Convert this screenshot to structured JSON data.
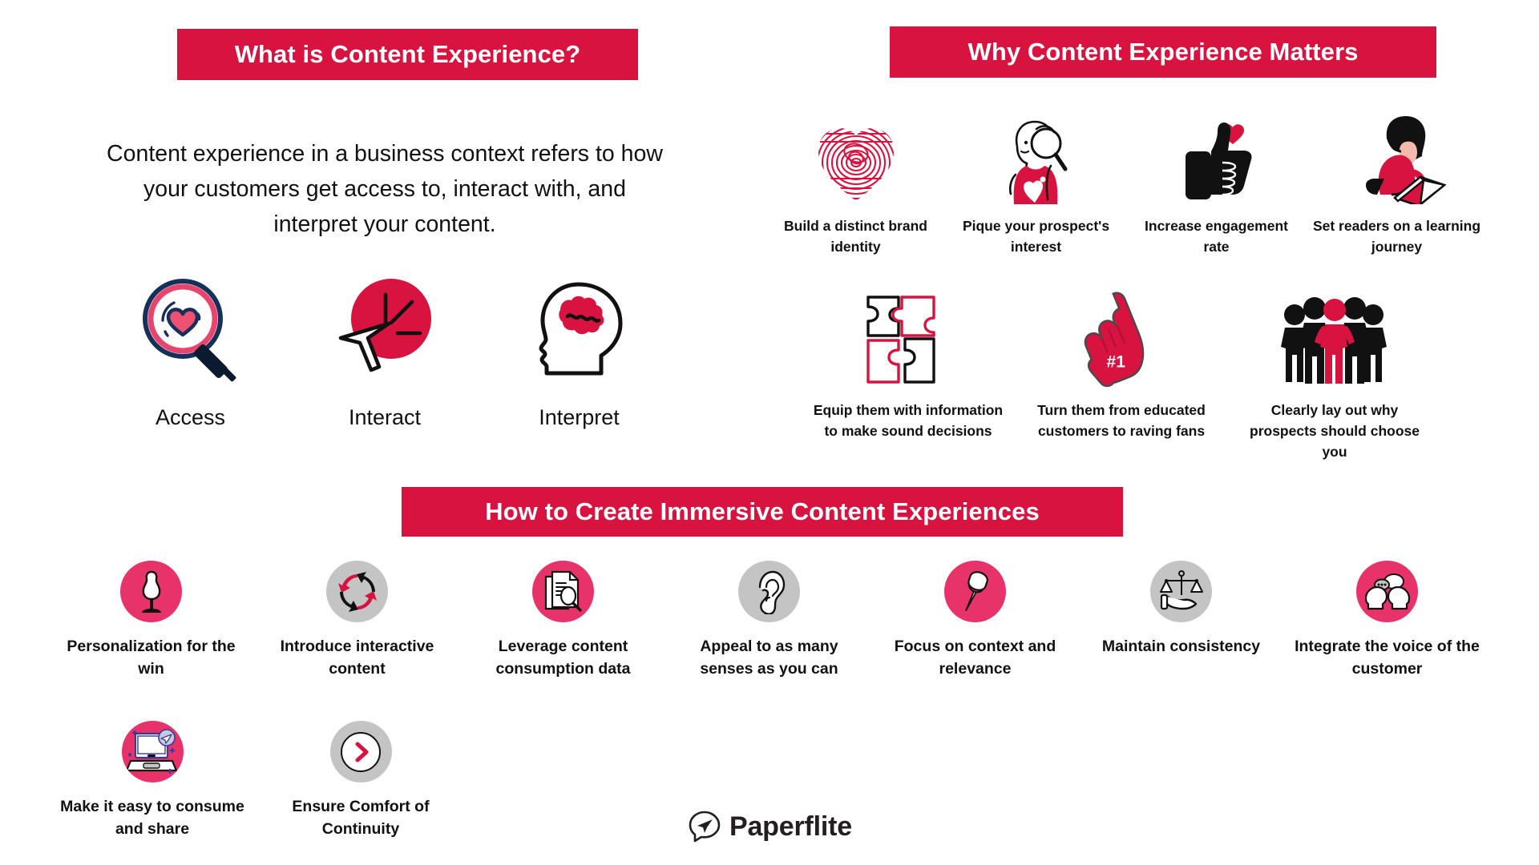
{
  "colors": {
    "crimson": "#D8133F",
    "pink": "#E8336A",
    "gray": "#C4C4C4",
    "navy": "#17305A",
    "black": "#111111"
  },
  "sections": {
    "what": {
      "title": "What is Content Experience?",
      "description": "Content experience in a business context refers to how your customers get access to, interact with, and interpret your content.",
      "items": [
        {
          "label": "Access",
          "icon": "magnifier-heart-icon"
        },
        {
          "label": "Interact",
          "icon": "cursor-click-icon"
        },
        {
          "label": "Interpret",
          "icon": "head-brain-icon"
        }
      ]
    },
    "why": {
      "title": "Why Content Experience Matters",
      "row1": [
        {
          "label": "Build a distinct brand identity",
          "icon": "fingerprint-heart-icon"
        },
        {
          "label": "Pique your prospect's interest",
          "icon": "person-magnifier-icon"
        },
        {
          "label": "Increase engagement rate",
          "icon": "thumbs-up-heart-icon"
        },
        {
          "label": "Set readers on a learning journey",
          "icon": "reader-book-icon"
        }
      ],
      "row2": [
        {
          "label": "Equip them with information to make sound decisions",
          "icon": "puzzle-pieces-icon"
        },
        {
          "label": "Turn them from educated customers to raving fans",
          "icon": "foam-finger-icon"
        },
        {
          "label": "Clearly lay out why prospects should choose you",
          "icon": "crowd-people-icon"
        }
      ]
    },
    "how": {
      "title": "How to Create Immersive Content Experiences",
      "row1": [
        {
          "label": "Personalization for the win",
          "icon": "mannequin-icon",
          "badge": "pink"
        },
        {
          "label": "Introduce interactive content",
          "icon": "cycle-arrows-icon",
          "badge": "gray"
        },
        {
          "label": "Leverage content consumption data",
          "icon": "document-magnifier-icon",
          "badge": "pink"
        },
        {
          "label": "Appeal to as many senses as you can",
          "icon": "ear-icon",
          "badge": "gray"
        },
        {
          "label": "Focus on context and relevance",
          "icon": "pushpin-icon",
          "badge": "pink"
        },
        {
          "label": "Maintain consistency",
          "icon": "balance-scale-hand-icon",
          "badge": "gray"
        },
        {
          "label": "Integrate the voice of the customer",
          "icon": "two-heads-speech-icon",
          "badge": "pink"
        }
      ],
      "row2": [
        {
          "label": "Make it easy to consume and share",
          "icon": "laptop-share-icon",
          "badge": "pink"
        },
        {
          "label": "Ensure Comfort of Continuity",
          "icon": "chevron-right-circle-icon",
          "badge": "gray"
        }
      ]
    }
  },
  "logo": {
    "name": "Paperflite",
    "icon": "paperflite-speech-plane-icon"
  }
}
